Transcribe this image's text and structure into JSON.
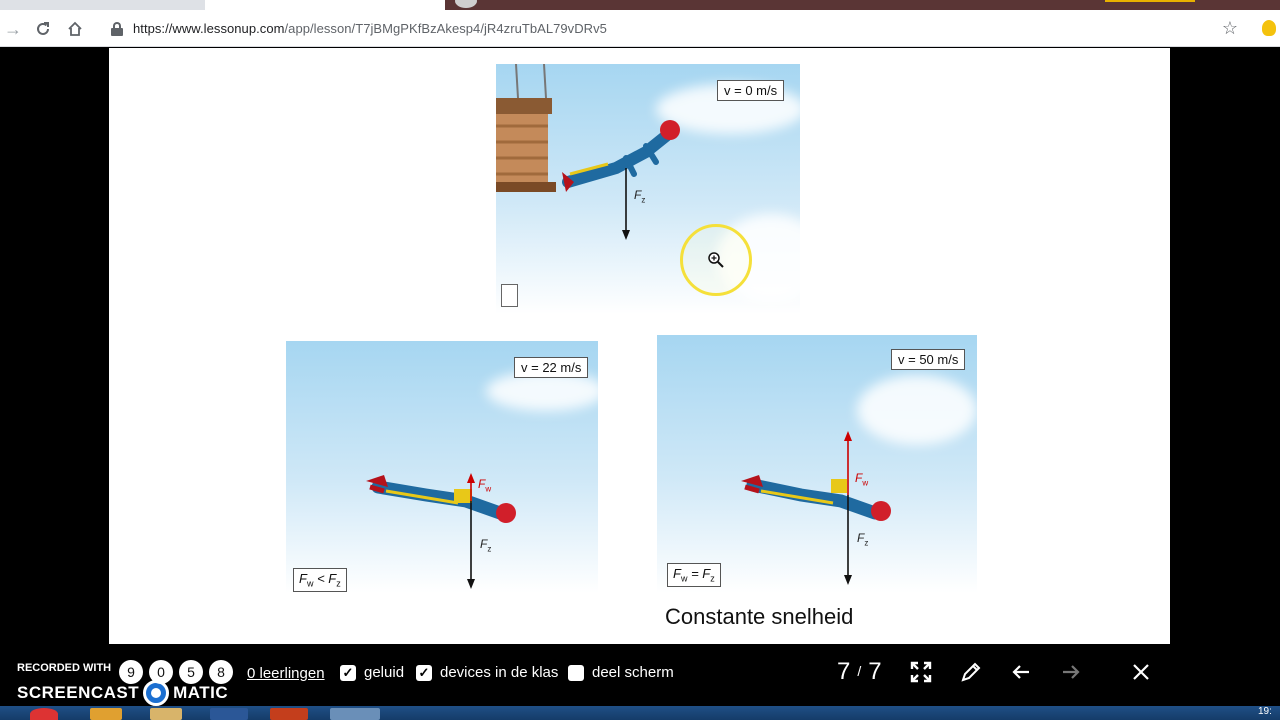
{
  "browser": {
    "url_host": "https://www.lessonup.com",
    "url_path": "/app/lesson/T7jBMgPKfBzAkesp4/jR4zruTbAL79vDRv5",
    "icons": [
      "back-arrow-icon",
      "reload-icon",
      "home-icon",
      "lock-icon",
      "star-icon",
      "extension-icon"
    ]
  },
  "slide": {
    "panel_top": {
      "velocity_label": "v =   0 m/s",
      "force_label": "F",
      "force_sub": "z"
    },
    "panel_left": {
      "velocity_label": "v = 22 m/s",
      "fw_label": "F",
      "fw_sub": "w",
      "fz_label": "F",
      "fz_sub": "z",
      "relation_a": "F",
      "relation_a_sub": "w",
      "relation_op": " < ",
      "relation_b": "F",
      "relation_b_sub": "z"
    },
    "panel_right": {
      "velocity_label": "v = 50 m/s",
      "fw_label": "F",
      "fw_sub": "w",
      "fz_label": "F",
      "fz_sub": "z",
      "relation_a": "F",
      "relation_a_sub": "w",
      "relation_op": " = ",
      "relation_b": "F",
      "relation_b_sub": "z"
    },
    "caption": "Constante snelheid"
  },
  "recorder": {
    "label": "RECORDED WITH",
    "brand_left": "SCREENCAST",
    "brand_right": "MATIC",
    "digits": [
      "9",
      "0",
      "5",
      "8"
    ]
  },
  "lesson_bar": {
    "students_link": "0 leerlingen",
    "option_sound": "geluid",
    "option_devices": "devices in de klas",
    "option_share": "deel scherm",
    "page_current": "7",
    "page_sep": "/",
    "page_total": "7",
    "icons": [
      "fullscreen-icon",
      "pencil-icon",
      "arrow-left-icon",
      "arrow-right-icon",
      "close-icon"
    ]
  },
  "taskbar": {
    "clock": "19:"
  },
  "colors": {
    "sky_top": "#a6d6f1",
    "force_black": "#111111",
    "force_red": "#cc0000",
    "highlight_ring": "#f5e03a"
  }
}
